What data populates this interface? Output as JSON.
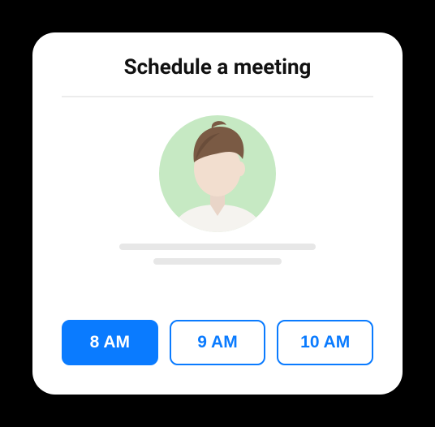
{
  "title": "Schedule a meeting",
  "slots": [
    {
      "label": "8 AM",
      "selected": true
    },
    {
      "label": "9 AM",
      "selected": false
    },
    {
      "label": "10 AM",
      "selected": false
    }
  ],
  "colors": {
    "accent": "#0a7bff"
  }
}
